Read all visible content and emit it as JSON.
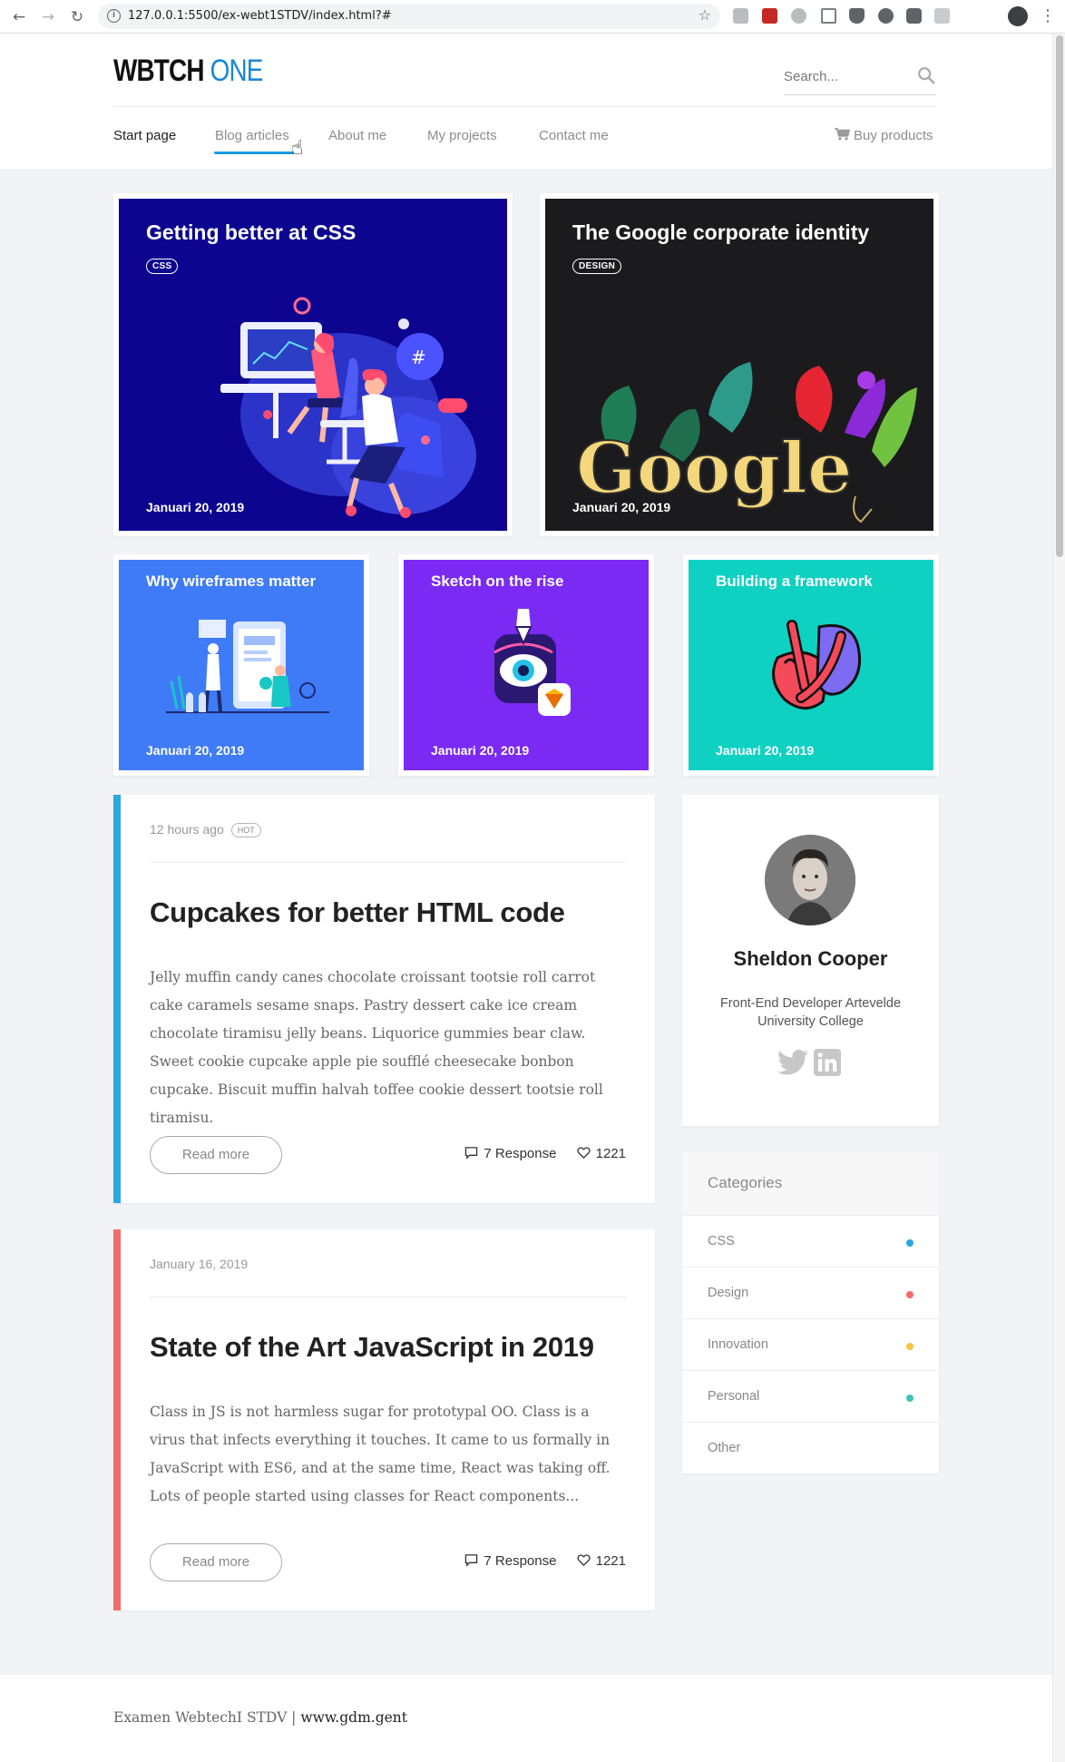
{
  "browser": {
    "url": "127.0.0.1:5500/ex-webt1STDV/index.html?#"
  },
  "header": {
    "logo_main": "WBTCH",
    "logo_accent": "ONE",
    "search_placeholder": "Search...",
    "nav": [
      {
        "label": "Start page",
        "active": true
      },
      {
        "label": "Blog articles",
        "active": false
      },
      {
        "label": "About me",
        "active": false
      },
      {
        "label": "My projects",
        "active": false
      },
      {
        "label": "Contact me",
        "active": false
      }
    ],
    "buy_label": "Buy products"
  },
  "featured": [
    {
      "title": "Getting better at CSS",
      "tag": "CSS",
      "date": "Januari 20, 2019",
      "bg": "#0d0490"
    },
    {
      "title": "The Google corporate identity",
      "tag": "DESIGN",
      "date": "Januari 20, 2019",
      "bg": "#1b1b1d"
    },
    {
      "title": "Why wireframes matter",
      "date": "Januari 20, 2019",
      "bg": "#3f7bf7"
    },
    {
      "title": "Sketch on the rise",
      "date": "Januari 20, 2019",
      "bg": "#7b2af4"
    },
    {
      "title": "Building a framework",
      "date": "Januari 20, 2019",
      "bg": "#0fd1c2"
    }
  ],
  "google_art_text": "Google",
  "posts": [
    {
      "meta": "12 hours ago",
      "badge": "HOT",
      "title": "Cupcakes for better HTML code",
      "body": "Jelly muffin candy canes chocolate croissant tootsie roll carrot cake caramels sesame snaps. Pastry dessert cake ice cream chocolate tiramisu jelly beans. Liquorice gummies bear claw. Sweet cookie cupcake apple pie soufflé cheesecake bonbon cupcake. Biscuit muffin halvah toffee cookie dessert tootsie roll tiramisu.",
      "read_more": "Read more",
      "responses": "7 Response",
      "likes": "1221",
      "accent": "#29a8e0"
    },
    {
      "meta": "January 16, 2019",
      "title": "State of the Art JavaScript in 2019",
      "body": "Class in JS is not harmless sugar for prototypal OO. Class is a virus that infects everything it touches. It came to us formally in JavaScript with ES6, and at the same time, React was taking off. Lots of people started using classes for React components...",
      "read_more": "Read more",
      "responses": "7 Response",
      "likes": "1221",
      "accent": "#f46b6b"
    }
  ],
  "profile": {
    "name": "Sheldon Cooper",
    "role": "Front-End Developer Artevelde University College",
    "socials": [
      "twitter-icon",
      "linkedin-icon"
    ]
  },
  "categories": {
    "title": "Categories",
    "items": [
      {
        "label": "CSS",
        "color": "#29a8e0"
      },
      {
        "label": "Design",
        "color": "#f46b6b"
      },
      {
        "label": "Innovation",
        "color": "#f7c244"
      },
      {
        "label": "Personal",
        "color": "#3fc1b4"
      },
      {
        "label": "Other",
        "color": ""
      }
    ]
  },
  "footer": {
    "text": "Examen WebtechI STDV | ",
    "link": "www.gdm.gent"
  }
}
